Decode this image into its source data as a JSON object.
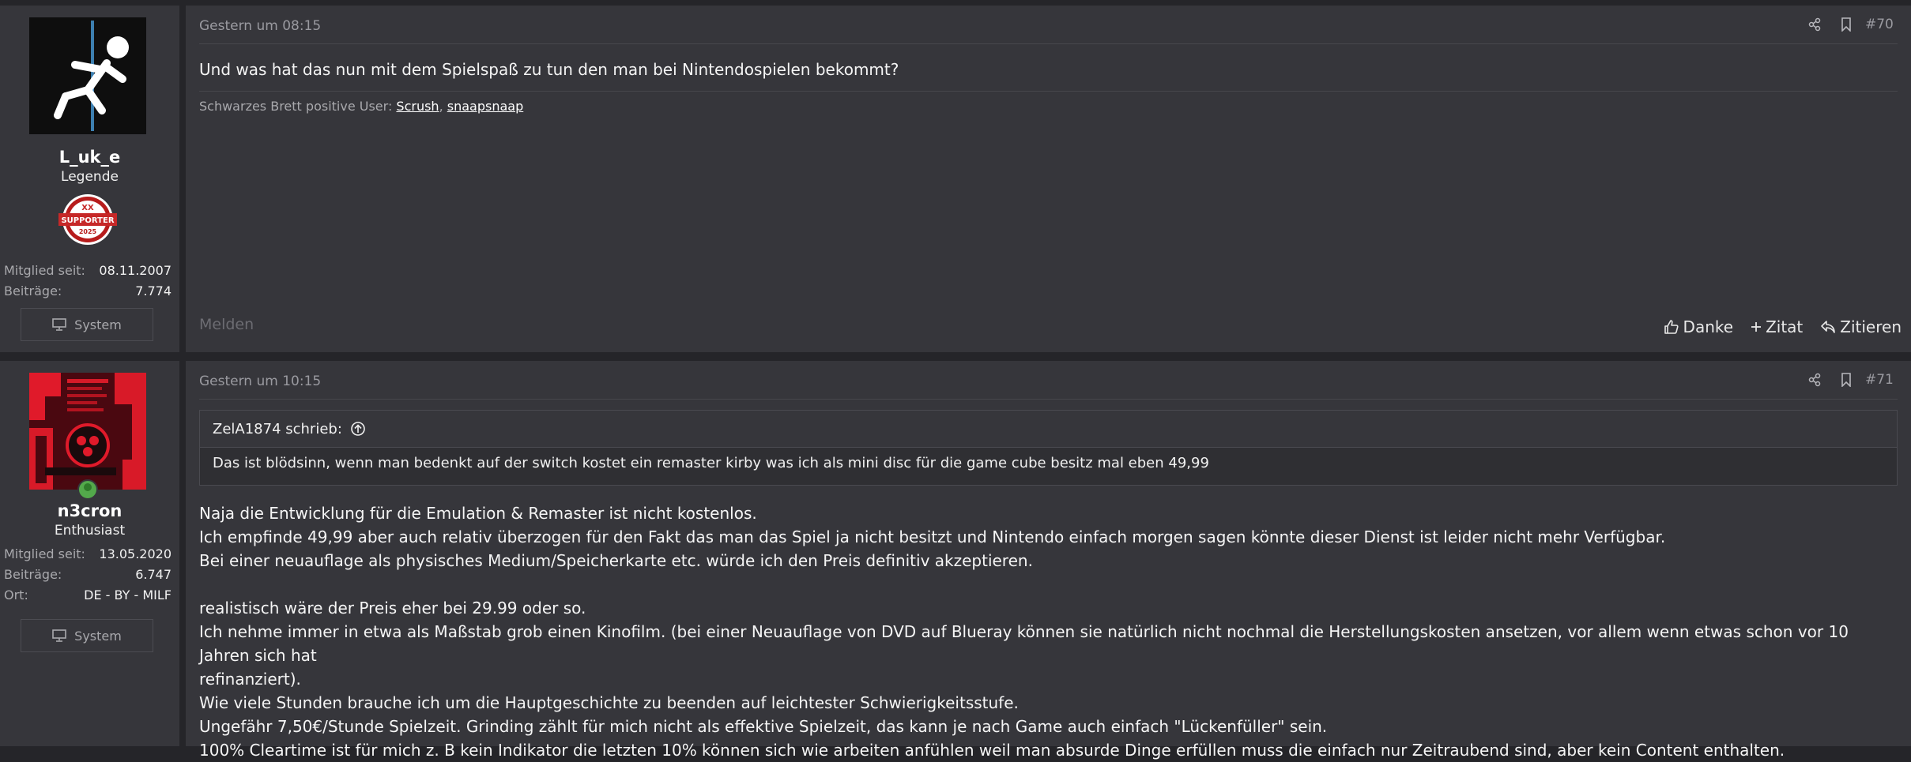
{
  "posts": [
    {
      "user": {
        "name": "L_uk_e",
        "title": "Legende",
        "badge": {
          "top": "XX",
          "main": "SUPPORTER",
          "year": "2025"
        },
        "stats": [
          {
            "label": "Mitglied seit:",
            "value": "08.11.2007"
          },
          {
            "label": "Beiträge:",
            "value": "7.774"
          }
        ],
        "system_label": "System"
      },
      "date": "Gestern um 08:15",
      "number": "#70",
      "message": "Und was hat das nun mit dem Spielspaß zu tun den man bei Nintendospielen bekommt?",
      "signature": {
        "label": "Schwarzes Brett positive User:",
        "users": [
          "Scrush",
          "snaapsnaap"
        ],
        "separator": ","
      },
      "report_label": "Melden",
      "actions": {
        "thanks": "Danke",
        "quote_add": "Zitat",
        "reply": "Zitieren"
      }
    },
    {
      "user": {
        "name": "n3cron",
        "title": "Enthusiast",
        "stats": [
          {
            "label": "Mitglied seit:",
            "value": "13.05.2020"
          },
          {
            "label": "Beiträge:",
            "value": "6.747"
          },
          {
            "label": "Ort:",
            "value": "DE - BY - MILF"
          }
        ],
        "system_label": "System"
      },
      "date": "Gestern um 10:15",
      "number": "#71",
      "quote": {
        "author": "ZelA1874 schrieb:",
        "text": "Das ist blödsinn, wenn man bedenkt auf der switch kostet ein remaster kirby was ich als mini disc für die game cube besitz mal eben 49,99"
      },
      "lines": [
        "Naja die Entwicklung für die Emulation & Remaster ist nicht kostenlos.",
        "Ich empfinde 49,99 aber auch relativ überzogen für den Fakt das man das Spiel ja nicht besitzt und Nintendo einfach morgen sagen könnte dieser Dienst ist leider nicht mehr Verfügbar.",
        "Bei einer neuauflage als physisches Medium/Speicherkarte etc. würde ich den Preis definitiv akzeptieren.",
        "",
        "realistisch wäre der Preis eher bei 29.99 oder so.",
        "Ich nehme immer in etwa als Maßstab grob einen Kinofilm. (bei einer Neuauflage von DVD auf Blueray können sie natürlich nicht nochmal die Herstellungskosten ansetzen, vor allem wenn etwas schon vor 10 Jahren sich hat",
        "refinanziert).",
        "Wie viele Stunden brauche ich um die Hauptgeschichte zu beenden auf leichtester Schwierigkeitsstufe.",
        "Ungefähr 7,50€/Stunde Spielzeit. Grinding zählt für mich nicht als effektive Spielzeit, das kann je nach Game auch einfach \"Lückenfüller\" sein.",
        "100% Cleartime ist für mich z. B kein Indikator die letzten 10% können sich wie arbeiten anfühlen weil man absurde Dinge erfüllen muss die einfach nur Zeitraubend sind, aber kein Content enthalten."
      ]
    }
  ],
  "colors": {
    "background": "#252529",
    "panel": "#36363b",
    "online": "#53a94b",
    "badge_red": "#c62828"
  }
}
